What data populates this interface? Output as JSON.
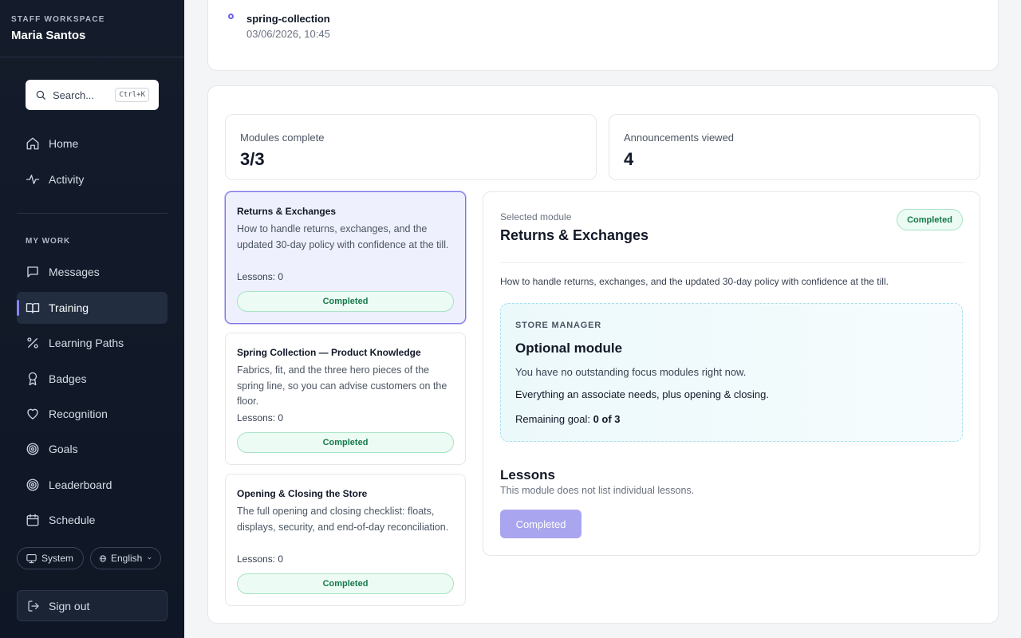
{
  "workspace": {
    "label": "STAFF WORKSPACE",
    "user": "Maria Santos"
  },
  "search": {
    "placeholder": "Search...",
    "shortcut": "Ctrl+K"
  },
  "nav": {
    "primary": [
      {
        "label": "Home",
        "icon": "home-icon"
      },
      {
        "label": "Activity",
        "icon": "activity-icon"
      }
    ],
    "section_label": "MY WORK",
    "work": [
      {
        "label": "Messages",
        "icon": "message-icon"
      },
      {
        "label": "Training",
        "icon": "book-open-icon",
        "active": true
      },
      {
        "label": "Learning Paths",
        "icon": "percent-icon"
      },
      {
        "label": "Badges",
        "icon": "award-icon"
      },
      {
        "label": "Recognition",
        "icon": "heart-icon"
      },
      {
        "label": "Goals",
        "icon": "target-icon"
      },
      {
        "label": "Leaderboard",
        "icon": "target-icon"
      },
      {
        "label": "Schedule",
        "icon": "calendar-icon"
      }
    ]
  },
  "footer": {
    "theme": "System",
    "language": "English",
    "signout": "Sign out"
  },
  "activity_item": {
    "title": "spring-collection",
    "time": "03/06/2026, 10:45"
  },
  "stats": [
    {
      "label": "Modules complete",
      "value": "3/3"
    },
    {
      "label": "Announcements viewed",
      "value": "4"
    }
  ],
  "modules": [
    {
      "title": "Returns & Exchanges",
      "description": "How to handle returns, exchanges, and the updated 30-day policy with confidence at the till.",
      "lessons": "Lessons: 0",
      "status": "Completed",
      "selected": true
    },
    {
      "title": "Spring Collection — Product Knowledge",
      "description": "Fabrics, fit, and the three hero pieces of the spring line, so you can advise customers on the floor.",
      "lessons": "Lessons: 0",
      "status": "Completed"
    },
    {
      "title": "Opening & Closing the Store",
      "description": "The full opening and closing checklist: floats, displays, security, and end-of-day reconciliation.",
      "lessons": "Lessons: 0",
      "status": "Completed"
    }
  ],
  "detail": {
    "kicker": "Selected module",
    "title": "Returns & Exchanges",
    "status": "Completed",
    "description": "How to handle returns, exchanges, and the updated 30-day policy with confidence at the till.",
    "callout": {
      "role": "STORE MANAGER",
      "title": "Optional module",
      "line1": "You have no outstanding focus modules right now.",
      "line2": "Everything an associate needs, plus opening & closing.",
      "goal_label": "Remaining goal:",
      "goal_value": "0 of 3"
    },
    "lessons_heading": "Lessons",
    "lessons_note": "This module does not list individual lessons.",
    "button": "Completed"
  },
  "colors": {
    "accent": "#6d63e8",
    "success": "#16794a",
    "sidebar": "#141c2b"
  }
}
